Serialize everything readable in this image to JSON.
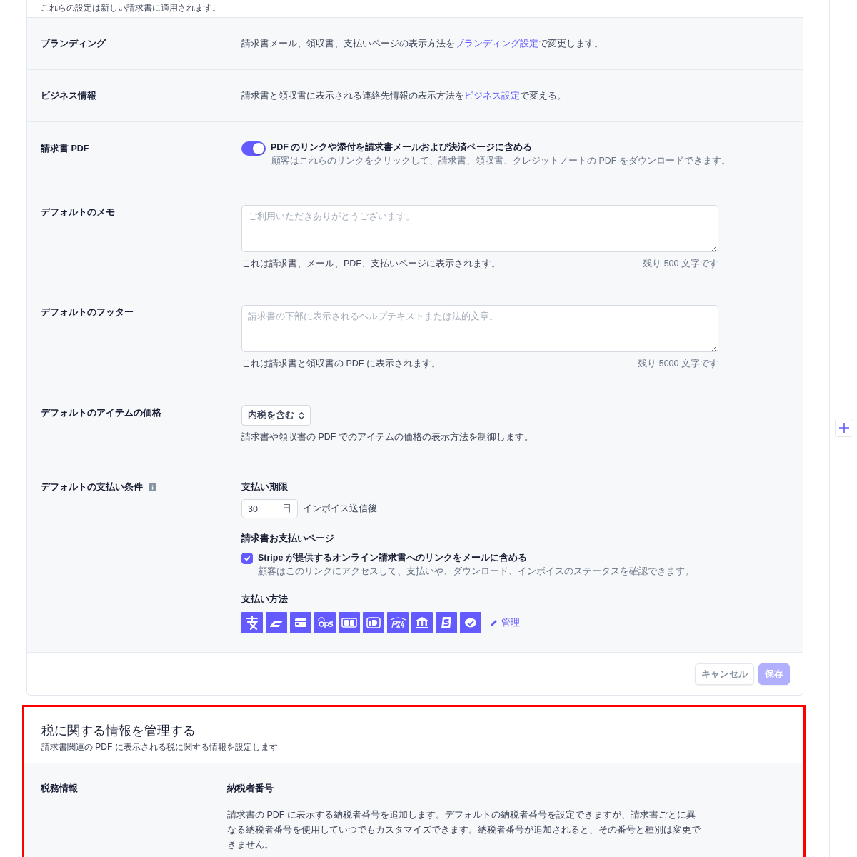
{
  "intro": "これらの設定は新しい請求書に適用されます。",
  "settings": [
    {
      "kind": "text",
      "label": "ブランディング",
      "before": "請求書メール、領収書、支払いページの表示方法を",
      "link": "ブランディング設定",
      "after": "で変更します。"
    },
    {
      "kind": "text",
      "label": "ビジネス情報",
      "before": "請求書と領収書に表示される連絡先情報の表示方法を",
      "link": "ビジネス設定",
      "after": "で変える。"
    },
    {
      "kind": "toggle",
      "label": "請求書 PDF",
      "on": true,
      "title": "PDF のリンクや添付を請求書メールおよび決済ページに含める",
      "description": "顧客はこれらのリンクをクリックして、請求書、領収書、クレジットノートの PDF をダウンロードできます。"
    },
    {
      "kind": "textarea",
      "label": "デフォルトのメモ",
      "placeholder": "ご利用いただきありがとうございます。",
      "hint": "これは請求書、メール、PDF、支払いページに表示されます。",
      "counter": "残り 500 文字です"
    },
    {
      "kind": "textarea",
      "label": "デフォルトのフッター",
      "placeholder": "請求書の下部に表示されるヘルプテキストまたは法的文章。",
      "hint": "これは請求書と領収書の PDF に表示されます。",
      "counter": "残り 5000 文字です"
    },
    {
      "kind": "select",
      "label": "デフォルトのアイテムの価格",
      "value": "内税を含む",
      "hint": "請求書や領収書の PDF でのアイテムの価格の表示方法を制御します。"
    },
    {
      "kind": "payment_terms",
      "label": "デフォルトの支払い条件",
      "due_label": "支払い期限",
      "days_value": "30",
      "days_unit": "日",
      "days_suffix": "インボイス送信後",
      "page_label": "請求書お支払いページ",
      "checkbox": {
        "checked": true,
        "label": "Stripe が提供するオンライン請求書へのリンクをメールに含める",
        "description": "顧客はこのリンクにアクセスして、支払いや、ダウンロード、インボイスのステータスを確認できます。"
      },
      "methods_label": "支払い方法",
      "methods": [
        {
          "kind": "alipay"
        },
        {
          "kind": "transfer"
        },
        {
          "kind": "card"
        },
        {
          "kind": "eps"
        },
        {
          "kind": "giropay"
        },
        {
          "kind": "ideal"
        },
        {
          "kind": "p24"
        },
        {
          "kind": "bank"
        },
        {
          "kind": "sofort"
        },
        {
          "kind": "wechat"
        }
      ],
      "manage": "管理"
    }
  ],
  "footer_buttons": [
    {
      "kind": "secondary",
      "label": "キャンセル",
      "disabled": false
    },
    {
      "kind": "primary",
      "label": "保存",
      "disabled": true
    }
  ],
  "tax": {
    "title": "税に関する情報を管理する",
    "subtitle": "請求書関連の PDF に表示される税に関する情報を設定します",
    "rows": [
      {
        "label": "税務情報",
        "heading": "納税者番号",
        "text": "請求書の PDF に表示する納税者番号を追加します。デフォルトの納税者番号を設定できますが、請求書ごとに異なる納税者番号を使用していつでもカスタマイズできます。納税者番号が追加されると、その番号と種別は変更できません。"
      }
    ]
  }
}
